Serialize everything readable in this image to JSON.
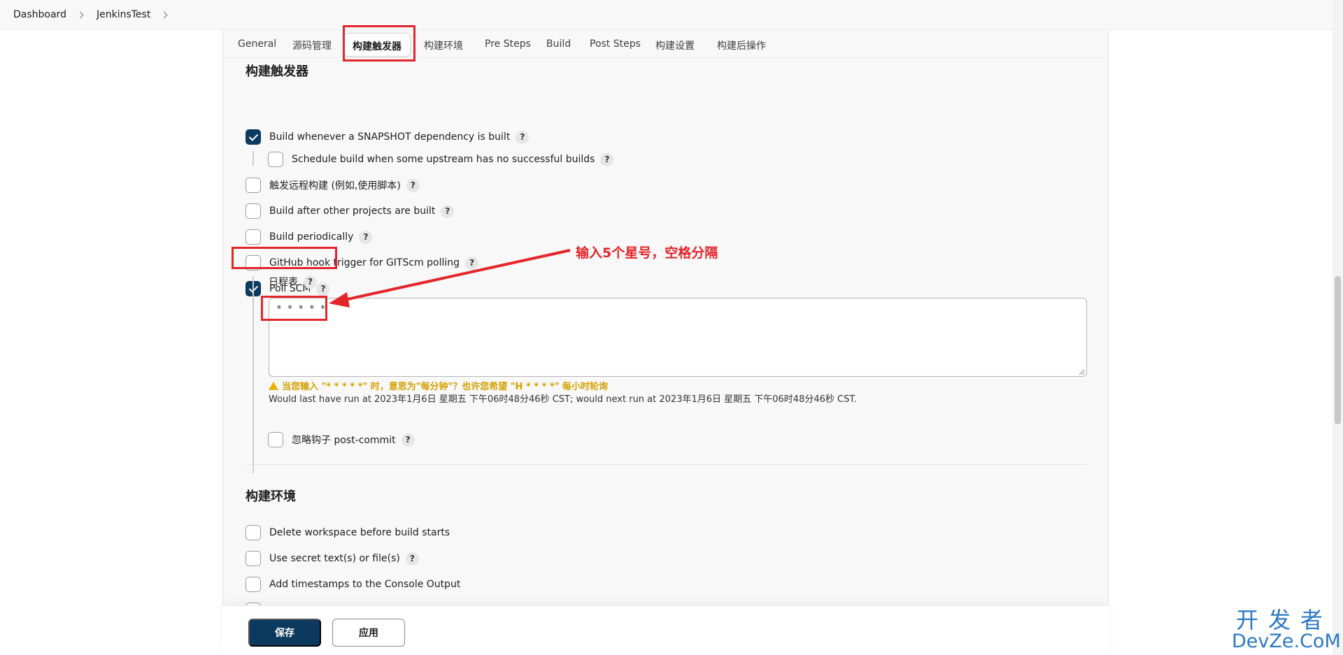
{
  "breadcrumb": [
    {
      "label": "Dashboard"
    },
    {
      "label": "JenkinsTest"
    }
  ],
  "tabs": [
    {
      "label": "General"
    },
    {
      "label": "源码管理"
    },
    {
      "label": "构建触发器",
      "active": true
    },
    {
      "label": "构建环境"
    },
    {
      "label": "Pre Steps"
    },
    {
      "label": "Build"
    },
    {
      "label": "Post Steps"
    },
    {
      "label": "构建设置"
    },
    {
      "label": "构建后操作"
    }
  ],
  "triggers": {
    "title": "构建触发器",
    "snapshot": {
      "label": "Build whenever a SNAPSHOT dependency is built",
      "checked": true
    },
    "upstream": {
      "label": "Schedule build when some upstream has no successful builds",
      "checked": false
    },
    "remote": {
      "label": "触发远程构建 (例如,使用脚本)",
      "checked": false
    },
    "after_other": {
      "label": "Build after other projects are built",
      "checked": false
    },
    "periodically": {
      "label": "Build periodically",
      "checked": false
    },
    "github_hook": {
      "label": "GitHub hook trigger for GITScm polling",
      "checked": false
    },
    "poll_scm": {
      "label": "Poll SCM",
      "checked": true
    },
    "schedule_label": "日程表",
    "schedule_value": "* * * * *",
    "warning": "当您输入 \"* * * * *\" 时，意思为\"每分钟\"？也许您希望 \"H * * * *\" 每小时轮询",
    "run_info": "Would last have run at 2023年1月6日 星期五 下午06时48分46秒 CST; would next run at 2023年1月6日 星期五 下午06时48分46秒 CST.",
    "ignore_hook": {
      "label": "忽略钩子 post-commit",
      "checked": false
    }
  },
  "environment": {
    "title": "构建环境",
    "delete_workspace": {
      "label": "Delete workspace before build starts",
      "checked": false
    },
    "secret_text": {
      "label": "Use secret text(s) or file(s)",
      "checked": false
    },
    "timestamps": {
      "label": "Add timestamps to the Console Output",
      "checked": false
    }
  },
  "help_glyph": "?",
  "buttons": {
    "save": "保存",
    "apply": "应用"
  },
  "annotation": {
    "text": "输入5个星号，空格分隔",
    "color": "#e3262b"
  },
  "watermark": {
    "line1": "开发者",
    "line2": "DevZe.CoM"
  },
  "colors": {
    "primary": "#0c3a5e",
    "warning": "#d4a000",
    "annotation": "#e3262b"
  }
}
